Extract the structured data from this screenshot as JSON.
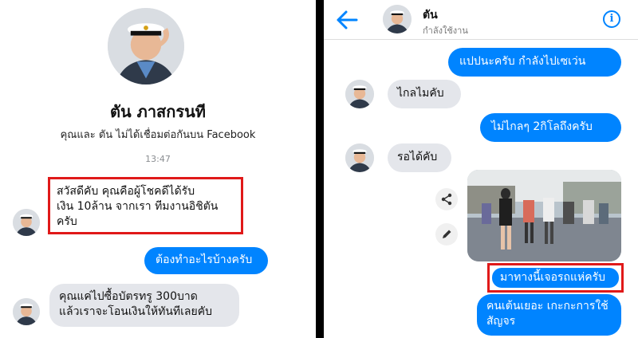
{
  "left": {
    "contact_name": "ตัน ภาสกรนที",
    "subtitle": "คุณและ ตัน ไม่ได้เชื่อมต่อกันบน Facebook",
    "timestamp": "13:47",
    "messages": [
      {
        "direction": "in",
        "lines": [
          "สวัสดีคับ คุณคือผู้โชคดีได้รับ",
          "เงิน 10ล้าน จากเรา ทีมงานอิชิตัน",
          "ครับ"
        ],
        "highlighted": true
      },
      {
        "direction": "out",
        "lines": [
          "ต้องทำอะไรบ้างครับ"
        ],
        "highlighted": false
      },
      {
        "direction": "in",
        "lines": [
          "คุณแค่ไปซื้อบัตรทรู 300บาด",
          "แล้วเราจะโอนเงินให้ทันทีเลยคับ"
        ],
        "highlighted": false
      }
    ]
  },
  "right": {
    "header": {
      "name": "ตัน",
      "status": "กำลังใช้งาน"
    },
    "messages": [
      {
        "direction": "out",
        "text": "แปปนะครับ กำลังไปเซเว่น"
      },
      {
        "direction": "in",
        "text": "ไกลไมคับ"
      },
      {
        "direction": "out",
        "text": "ไม่ไกลๆ 2กิโลถึงครับ"
      },
      {
        "direction": "in",
        "text": "รอได้คับ"
      },
      {
        "direction": "out",
        "text": "มาทางนี้เจอรถแห่ครับ",
        "highlighted": true
      },
      {
        "direction": "out",
        "lines": [
          "คนเต้นเยอะ เกะกะการใช้",
          "สัญจร"
        ]
      }
    ]
  },
  "colors": {
    "accent": "#0084ff",
    "highlight": "#e01919",
    "incoming_bubble": "#e4e6eb"
  },
  "icons": [
    "back-arrow-icon",
    "info-icon",
    "share-icon",
    "edit-icon"
  ]
}
